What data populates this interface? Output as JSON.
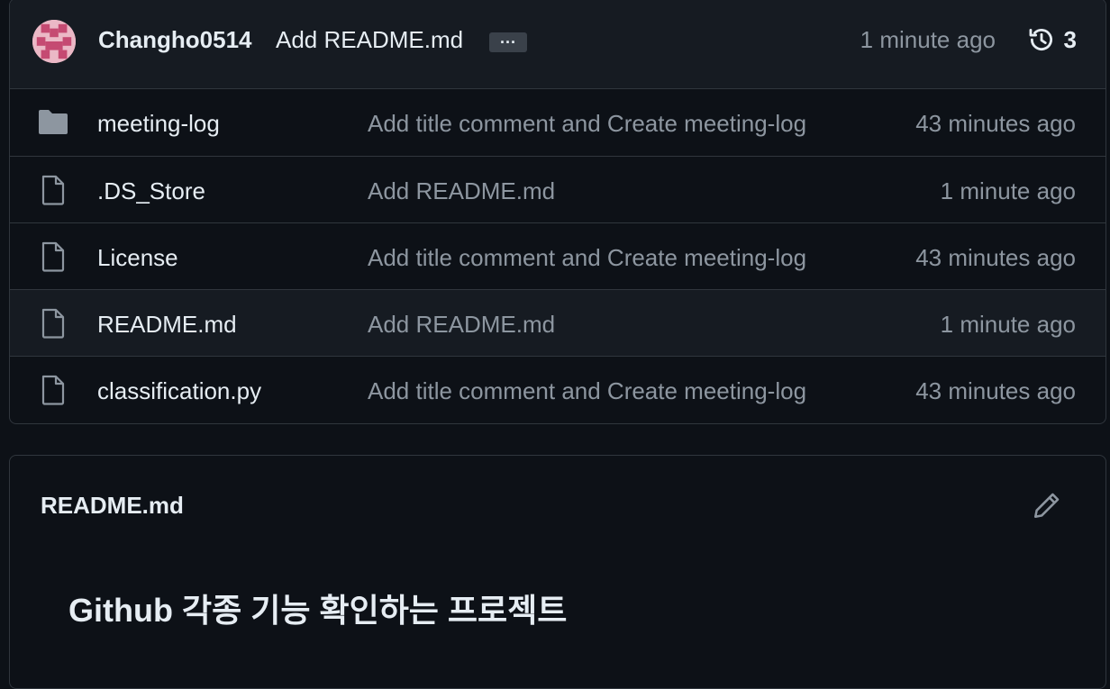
{
  "commit": {
    "author": "Changho0514",
    "message": "Add README.md",
    "ellipsis": "...",
    "time": "1 minute ago",
    "history_count": "3"
  },
  "files": [
    {
      "name": "meeting-log",
      "type": "folder",
      "message": "Add title comment and Create meeting-log",
      "time": "43 minutes ago"
    },
    {
      "name": ".DS_Store",
      "type": "file",
      "message": "Add README.md",
      "time": "1 minute ago"
    },
    {
      "name": "License",
      "type": "file",
      "message": "Add title comment and Create meeting-log",
      "time": "43 minutes ago"
    },
    {
      "name": "README.md",
      "type": "file",
      "message": "Add README.md",
      "time": "1 minute ago"
    },
    {
      "name": "classification.py",
      "type": "file",
      "message": "Add title comment and Create meeting-log",
      "time": "43 minutes ago"
    }
  ],
  "readme": {
    "title": "README.md",
    "heading": "Github 각종 기능 확인하는 프로젝트"
  },
  "icons": {
    "folder": "folder-icon",
    "file": "file-icon",
    "history": "history-icon",
    "edit": "pencil-icon"
  },
  "colors": {
    "background": "#0d1117",
    "header": "#161b22",
    "border": "#30363d",
    "muted_text": "#8d96a0",
    "avatar": "#ebb8c6"
  }
}
